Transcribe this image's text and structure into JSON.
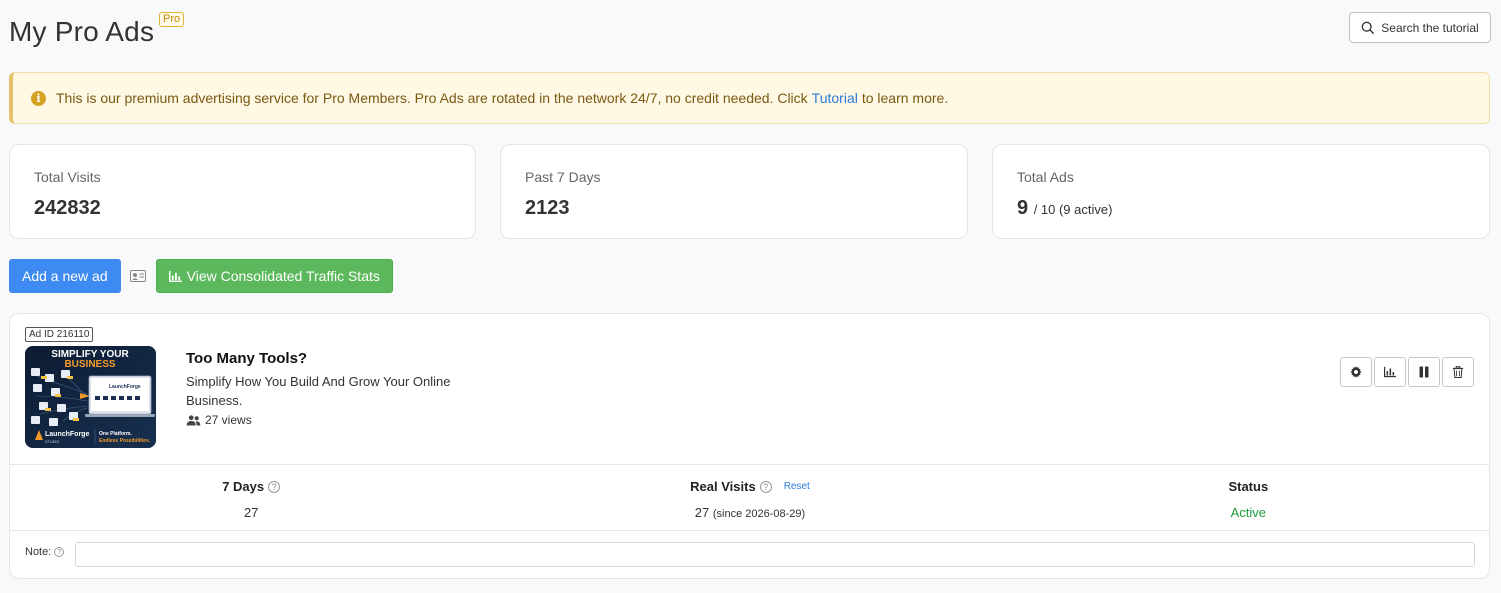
{
  "header": {
    "title": "My Pro Ads",
    "badge": "Pro",
    "search_label": "Search the tutorial"
  },
  "alert": {
    "text_before": "This is our premium advertising service for Pro Members. Pro Ads are rotated in the network 24/7, no credit needed. Click",
    "link": "Tutorial",
    "text_after": "to learn more."
  },
  "stats": [
    {
      "label": "Total Visits",
      "value": "242832"
    },
    {
      "label": "Past 7 Days",
      "value": "2123"
    },
    {
      "label": "Total Ads",
      "value": "9",
      "sub": "/ 10 (9 active)"
    }
  ],
  "actions": {
    "add_label": "Add a new ad",
    "stats_label": "View Consolidated Traffic Stats"
  },
  "ad": {
    "id_tag": "Ad ID 216110",
    "thumbnail": {
      "headline1": "SIMPLIFY YOUR",
      "headline2": "BUSINESS",
      "brand": "LaunchForge",
      "brand_sub": "STUDIO",
      "tagline1": "One Platform.",
      "tagline2": "Endless Possibilities."
    },
    "title": "Too Many Tools?",
    "description": "Simplify How You Build And Grow Your Online Business.",
    "views": "27 views",
    "stats": {
      "days_label": "7 Days",
      "days_value": "27",
      "real_label": "Real Visits",
      "reset_label": "Reset",
      "real_value": "27",
      "real_since": "(since 2026-08-29)",
      "status_label": "Status",
      "status_value": "Active"
    },
    "note_label": "Note:",
    "note_value": ""
  },
  "colors": {
    "primary": "#3d8bf2",
    "success": "#5cb85c",
    "alert_bg": "#fff8e4",
    "status_active": "#1f9c3a"
  }
}
